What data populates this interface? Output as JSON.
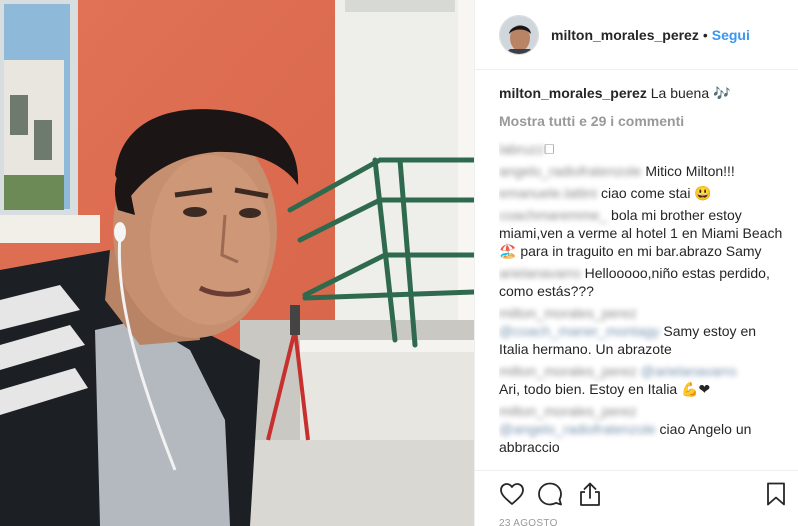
{
  "post": {
    "header": {
      "username": "milton_morales_perez",
      "separator": "•",
      "follow_label": "Segui"
    },
    "caption": {
      "username": "milton_morales_perez",
      "text": " La buena 🎶"
    },
    "view_all_label": "Mostra tutti e 29 i commenti",
    "comments": [
      {
        "username": "labruzz",
        "text": "🗆"
      },
      {
        "username": "angelo_radiofratenzole",
        "text": "Mitico Milton!!!"
      },
      {
        "username": "emanuele.lattini",
        "text": "ciao come stai 😃"
      },
      {
        "username": "coachmaremme_",
        "text": "bola mi brother estoy miami,ven a verme al hotel 1 en Miami Beach 🏖️ para in traguito en mi bar.abrazo Samy"
      },
      {
        "username": "arielanavarro",
        "text": "Hellooooo,niño estas perdido, como estás???"
      },
      {
        "username": "milton_morales_perez",
        "mention": "@coach_maner_montagy",
        "text": " Samy estoy en Italia hermano. Un abrazote"
      },
      {
        "username": "milton_morales_perez",
        "mention": "@arielanavarro",
        "text": "Ari, todo bien. Estoy en Italia 💪❤"
      },
      {
        "username": "milton_morales_perez",
        "mention": "@angelo_radiofratenzole",
        "text": "ciao Angelo un abbraccio"
      }
    ],
    "date": "23 AGOSTO",
    "icons": {
      "like": "heart-icon",
      "comment": "comment-icon",
      "share": "share-icon",
      "save": "bookmark-icon"
    }
  }
}
